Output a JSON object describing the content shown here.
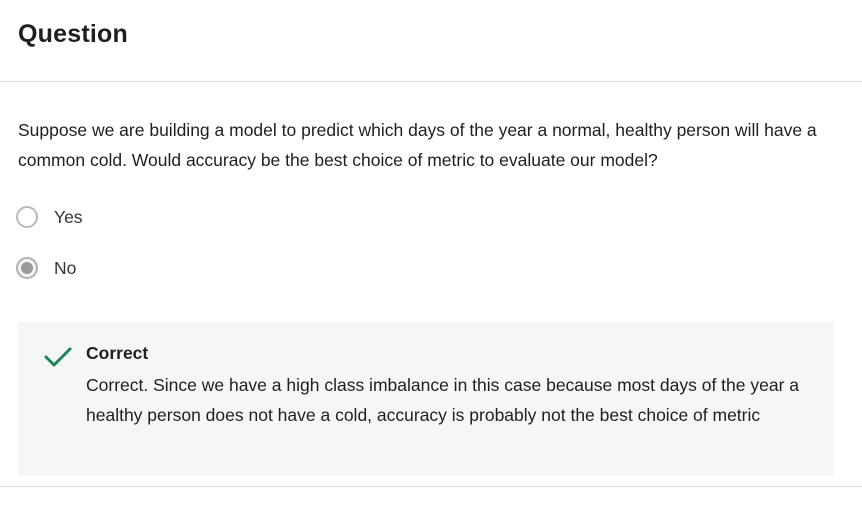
{
  "header": {
    "title": "Question"
  },
  "question": {
    "prompt": "Suppose we are building a model to predict which days of the year a normal, healthy person will have a common cold.  Would accuracy be the best choice of metric to evaluate our model?",
    "options": [
      {
        "label": "Yes",
        "selected": false
      },
      {
        "label": "No",
        "selected": true
      }
    ]
  },
  "feedback": {
    "status": "Correct",
    "message": "Correct.  Since we have a high class imbalance in this case because most days of the year a healthy person does not have a cold, accuracy is probably not the best choice of metric",
    "icon": "checkmark-icon",
    "accent_color": "#1f8354"
  }
}
